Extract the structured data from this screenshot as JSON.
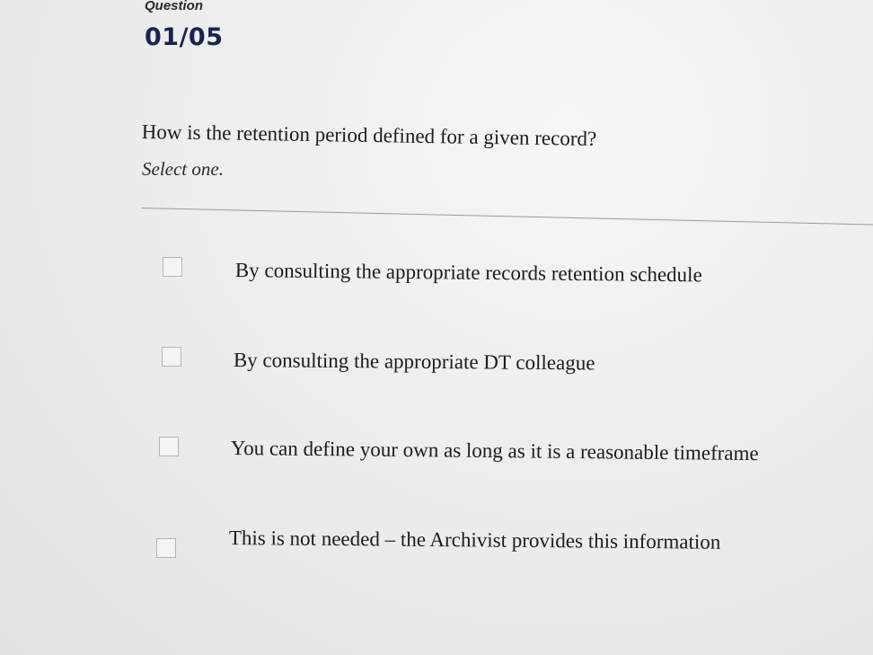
{
  "question": {
    "label": "Question",
    "counter": "01/05",
    "text": "How is the retention period defined for a given record?",
    "instruction": "Select one."
  },
  "options": [
    {
      "label": "By consulting the appropriate records retention schedule",
      "checked": false
    },
    {
      "label": "By consulting the appropriate DT colleague",
      "checked": false
    },
    {
      "label": "You can define your own as long as it is a reasonable timeframe",
      "checked": false
    },
    {
      "label": "This is not needed – the Archivist provides this information",
      "checked": false
    }
  ]
}
